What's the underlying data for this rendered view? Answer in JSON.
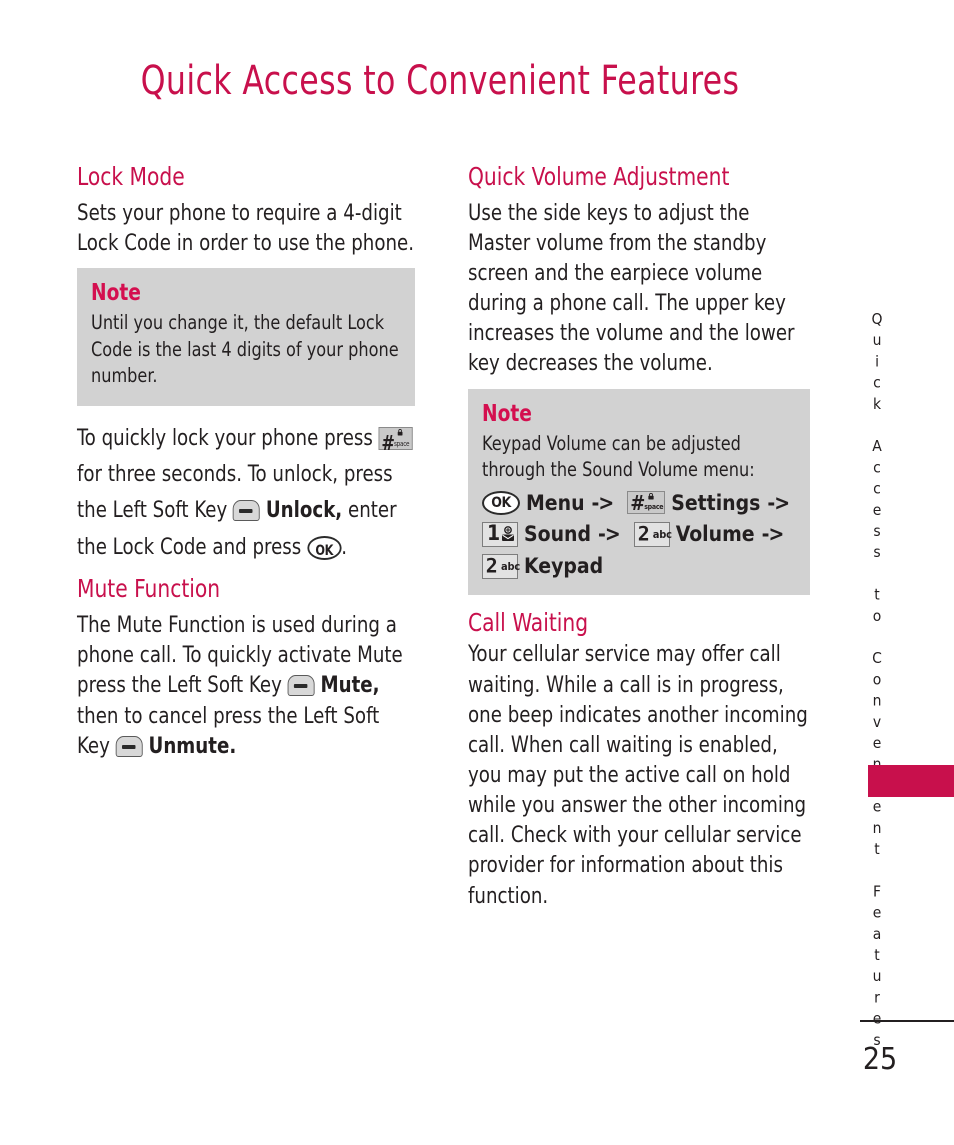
{
  "page": {
    "title": "Quick Access to Convenient Features",
    "side_tab_text": "Quick Access to Convenient Features",
    "page_number": "25",
    "accent_color": "#C8104C",
    "note_bg_color": "#D2D2D2",
    "text_color": "#231F20"
  },
  "left_column": {
    "lock_mode": {
      "heading": "Lock Mode",
      "paragraph": "Sets your phone to require a 4-digit Lock Code in order to use the phone.",
      "note": {
        "title": "Note",
        "text": "Until you change it, the default Lock Code is the last 4 digits of your phone number."
      },
      "instructions": {
        "part1": "To quickly lock your phone press",
        "part2": "for three seconds. To unlock, press the Left Soft Key",
        "part3_bold": "Unlock,",
        "part4": "enter the Lock Code and press",
        "part5": "."
      }
    },
    "mute_function": {
      "heading": "Mute Function",
      "part1": "The Mute Function is used during a phone call. To quickly activate Mute press the Left Soft Key",
      "part2_bold": "Mute,",
      "part3": "then to cancel press the Left Soft Key",
      "part4_bold": "Unmute."
    }
  },
  "right_column": {
    "quick_volume": {
      "heading": "Quick Volume Adjustment",
      "paragraph": "Use the side keys to adjust the Master volume from the standby screen and the earpiece volume during a phone call. The upper key increases the volume and the lower key decreases the volume.",
      "note": {
        "title": "Note",
        "text": "Keypad Volume can be adjusted through the Sound Volume menu:",
        "menu_path": [
          {
            "key": "ok-key",
            "key_label": "OK",
            "label": "Menu",
            "arrow": "->"
          },
          {
            "key": "hash-space-key",
            "key_label": "#",
            "key_sublabel": "space",
            "label": "Settings",
            "arrow": "->"
          },
          {
            "key": "one-key",
            "key_label": "1",
            "label": "Sound",
            "arrow": "->"
          },
          {
            "key": "two-abc-key",
            "key_label": "2",
            "key_sublabel": "abc",
            "label": "Volume",
            "arrow": "->"
          },
          {
            "key": "two-abc-key",
            "key_label": "2",
            "key_sublabel": "abc",
            "label": "Keypad",
            "arrow": ""
          }
        ]
      }
    },
    "call_waiting": {
      "heading": "Call Waiting",
      "paragraph": "Your cellular service may offer call waiting. While a call is in progress, one beep indicates another incoming call. When call waiting is enabled, you may put the active call on hold while you answer the other incoming call. Check with your cellular service provider for information about this function."
    }
  }
}
